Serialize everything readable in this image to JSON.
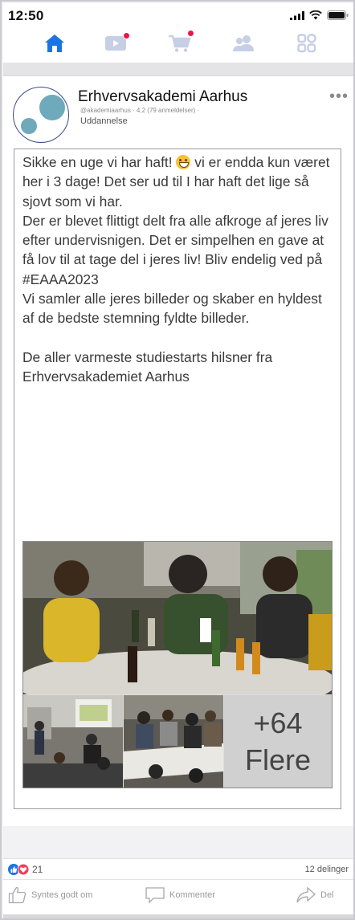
{
  "status_bar": {
    "time": "12:50"
  },
  "nav": {
    "items": [
      {
        "name": "home",
        "icon": "home-icon",
        "active": true
      },
      {
        "name": "video",
        "icon": "video-icon",
        "badge": true
      },
      {
        "name": "marketplace",
        "icon": "cart-icon",
        "badge": true
      },
      {
        "name": "groups",
        "icon": "people-icon"
      },
      {
        "name": "menu",
        "icon": "grid-menu-icon"
      }
    ],
    "active_color": "#1b74e4",
    "inactive_color": "#c7cfe6",
    "badge_color": "#e8174a"
  },
  "post": {
    "page_name": "Erhvervsakademi Aarhus",
    "meta": "@akademiaarhus · 4,2 (79 anmeldelser) ·",
    "category": "Uddannelse",
    "text_1a": "Sikke en uge vi har haft! ",
    "text_1b": "  vi er endda kun været her i 3 dage! Det ser ud til I har haft det lige så sjovt som vi har.",
    "text_2": "Der er blevet flittigt delt fra alle afkroge af jeres liv efter undervisnigen. Det er simpelhen en gave at få lov til at tage del i jeres liv! Bliv endelig ved på #EAAA2023",
    "text_3": "Vi samler alle jeres billeder og skaber en hyldest af de bedste stemning fyldte billeder.",
    "text_4": "De aller varmeste studiestarts hilsner fra Erhvervsakademiet Aarhus",
    "more_photos_count": "+64",
    "more_photos_label": "Flere"
  },
  "footer": {
    "reactions_count": "21",
    "shares": "12 delinger",
    "like_label": "Syntes godt om",
    "comment_label": "Kommenter",
    "share_label": "Del"
  }
}
